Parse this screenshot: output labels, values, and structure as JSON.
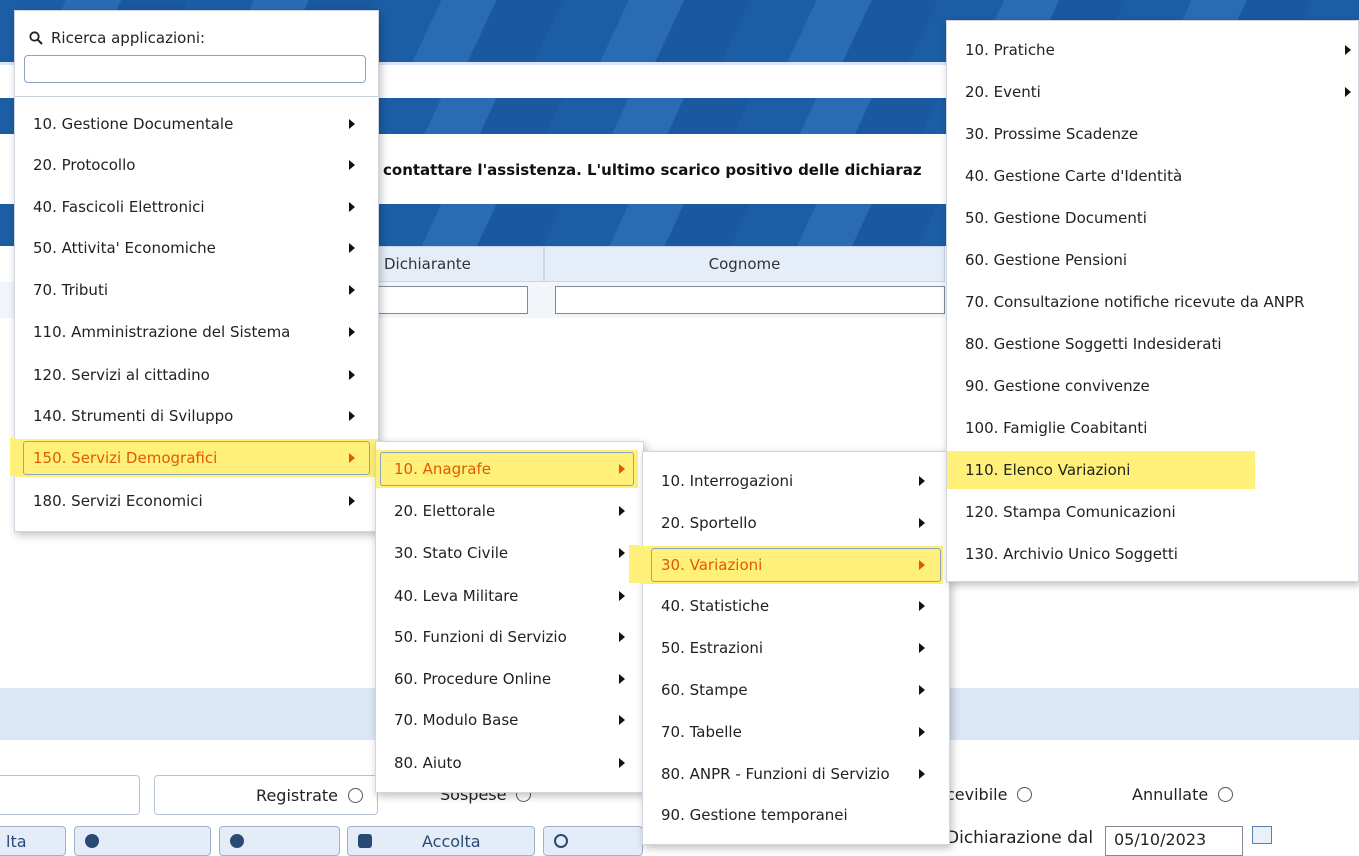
{
  "background": {
    "notice": "contattare l'assistenza. L'ultimo scarico positivo delle dichiaraz",
    "table_headers": [
      "Dichiarante",
      "Cognome"
    ],
    "filters": [
      "Registrate",
      "Sospese",
      "cevibile",
      "Annullate"
    ],
    "buttons": [
      "lta",
      "",
      "",
      "Accolta",
      ""
    ],
    "date_label": "Dichiarazione dal",
    "date_value": "05/10/2023"
  },
  "search": {
    "label": "Ricerca applicazioni:",
    "placeholder": ""
  },
  "menu1": [
    "10. Gestione Documentale",
    "20. Protocollo",
    "40. Fascicoli Elettronici",
    "50. Attivita' Economiche",
    "70. Tributi",
    "110. Amministrazione del Sistema",
    "120. Servizi al cittadino",
    "140. Strumenti di Sviluppo",
    "150. Servizi Demografici",
    "180. Servizi Economici"
  ],
  "menu2": [
    "10. Anagrafe",
    "20. Elettorale",
    "30. Stato Civile",
    "40. Leva Militare",
    "50. Funzioni di Servizio",
    "60. Procedure Online",
    "70. Modulo Base",
    "80. Aiuto"
  ],
  "menu3": [
    "10. Interrogazioni",
    "20. Sportello",
    "30. Variazioni",
    "40. Statistiche",
    "50. Estrazioni",
    "60. Stampe",
    "70. Tabelle",
    "80. ANPR - Funzioni di Servizio",
    "90. Gestione temporanei"
  ],
  "menu4": [
    "10. Pratiche",
    "20. Eventi",
    "30. Prossime Scadenze",
    "40. Gestione Carte d'Identità",
    "50. Gestione Documenti",
    "60. Gestione Pensioni",
    "70. Consultazione notifiche ricevute da ANPR",
    "80. Gestione Soggetti Indesiderati",
    "90. Gestione convivenze",
    "100. Famiglie Coabitanti",
    "110. Elenco Variazioni",
    "120. Stampa Comunicazioni",
    "130. Archivio Unico Soggetti"
  ],
  "icons": {
    "search": "search-icon",
    "submenu": "caret-right-icon",
    "calendar": "calendar-icon"
  },
  "colors": {
    "highlight": "#fff07a",
    "highlight_text": "#e25a00",
    "header_blue": "#1c5ea5"
  }
}
